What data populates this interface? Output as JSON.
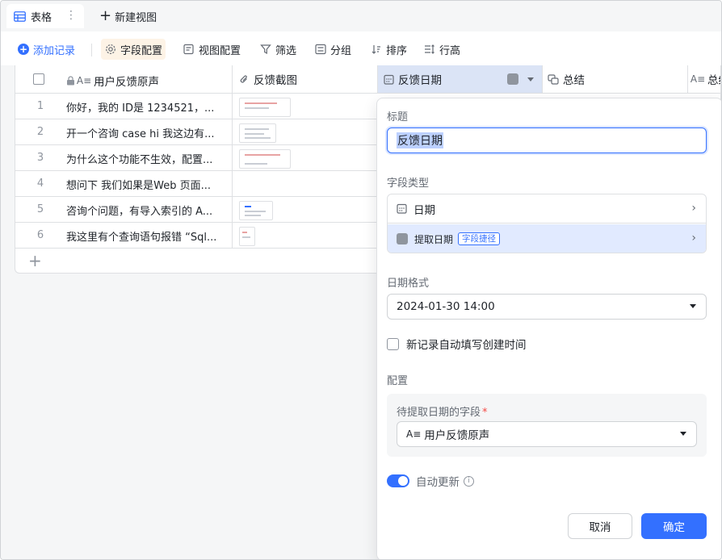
{
  "view_tabs": {
    "active_label": "表格",
    "new_view_label": "新建视图"
  },
  "toolbar": {
    "add_record": "添加记录",
    "field_config": "字段配置",
    "view_config": "视图配置",
    "filter": "筛选",
    "group": "分组",
    "sort": "排序",
    "row_height": "行高"
  },
  "grid": {
    "columns": [
      "用户反馈原声",
      "反馈截图",
      "反馈日期",
      "总结",
      "总结"
    ],
    "rows": [
      {
        "num": "1",
        "text": "你好，我的 ID是 1234521，..."
      },
      {
        "num": "2",
        "text": "开一个咨询 case hi 我这边有..."
      },
      {
        "num": "3",
        "text": "为什么这个功能不生效，配置..."
      },
      {
        "num": "4",
        "text": "想问下 我们如果是Web 页面..."
      },
      {
        "num": "5",
        "text": "咨询个问题，有导入索引的 A..."
      },
      {
        "num": "6",
        "text": "我这里有个查询语句报错 “Sql..."
      }
    ],
    "add_row_symbol": "+"
  },
  "field_panel": {
    "title_label": "标题",
    "title_value": "反馈日期",
    "type_label": "字段类型",
    "type_option": "日期",
    "shortcut_option": "提取日期",
    "shortcut_badge": "字段捷径",
    "date_format_label": "日期格式",
    "date_format_value": "2024-01-30 14:00",
    "auto_fill_label": "新记录自动填写创建时间",
    "config_label": "配置",
    "source_field_label": "待提取日期的字段",
    "source_field_value": "用户反馈原声",
    "auto_update_label": "自动更新",
    "cancel": "取消",
    "confirm": "确定"
  },
  "colors": {
    "accent": "#3370ff",
    "highlight_bg": "#e1eaff",
    "required": "#f54a45"
  }
}
